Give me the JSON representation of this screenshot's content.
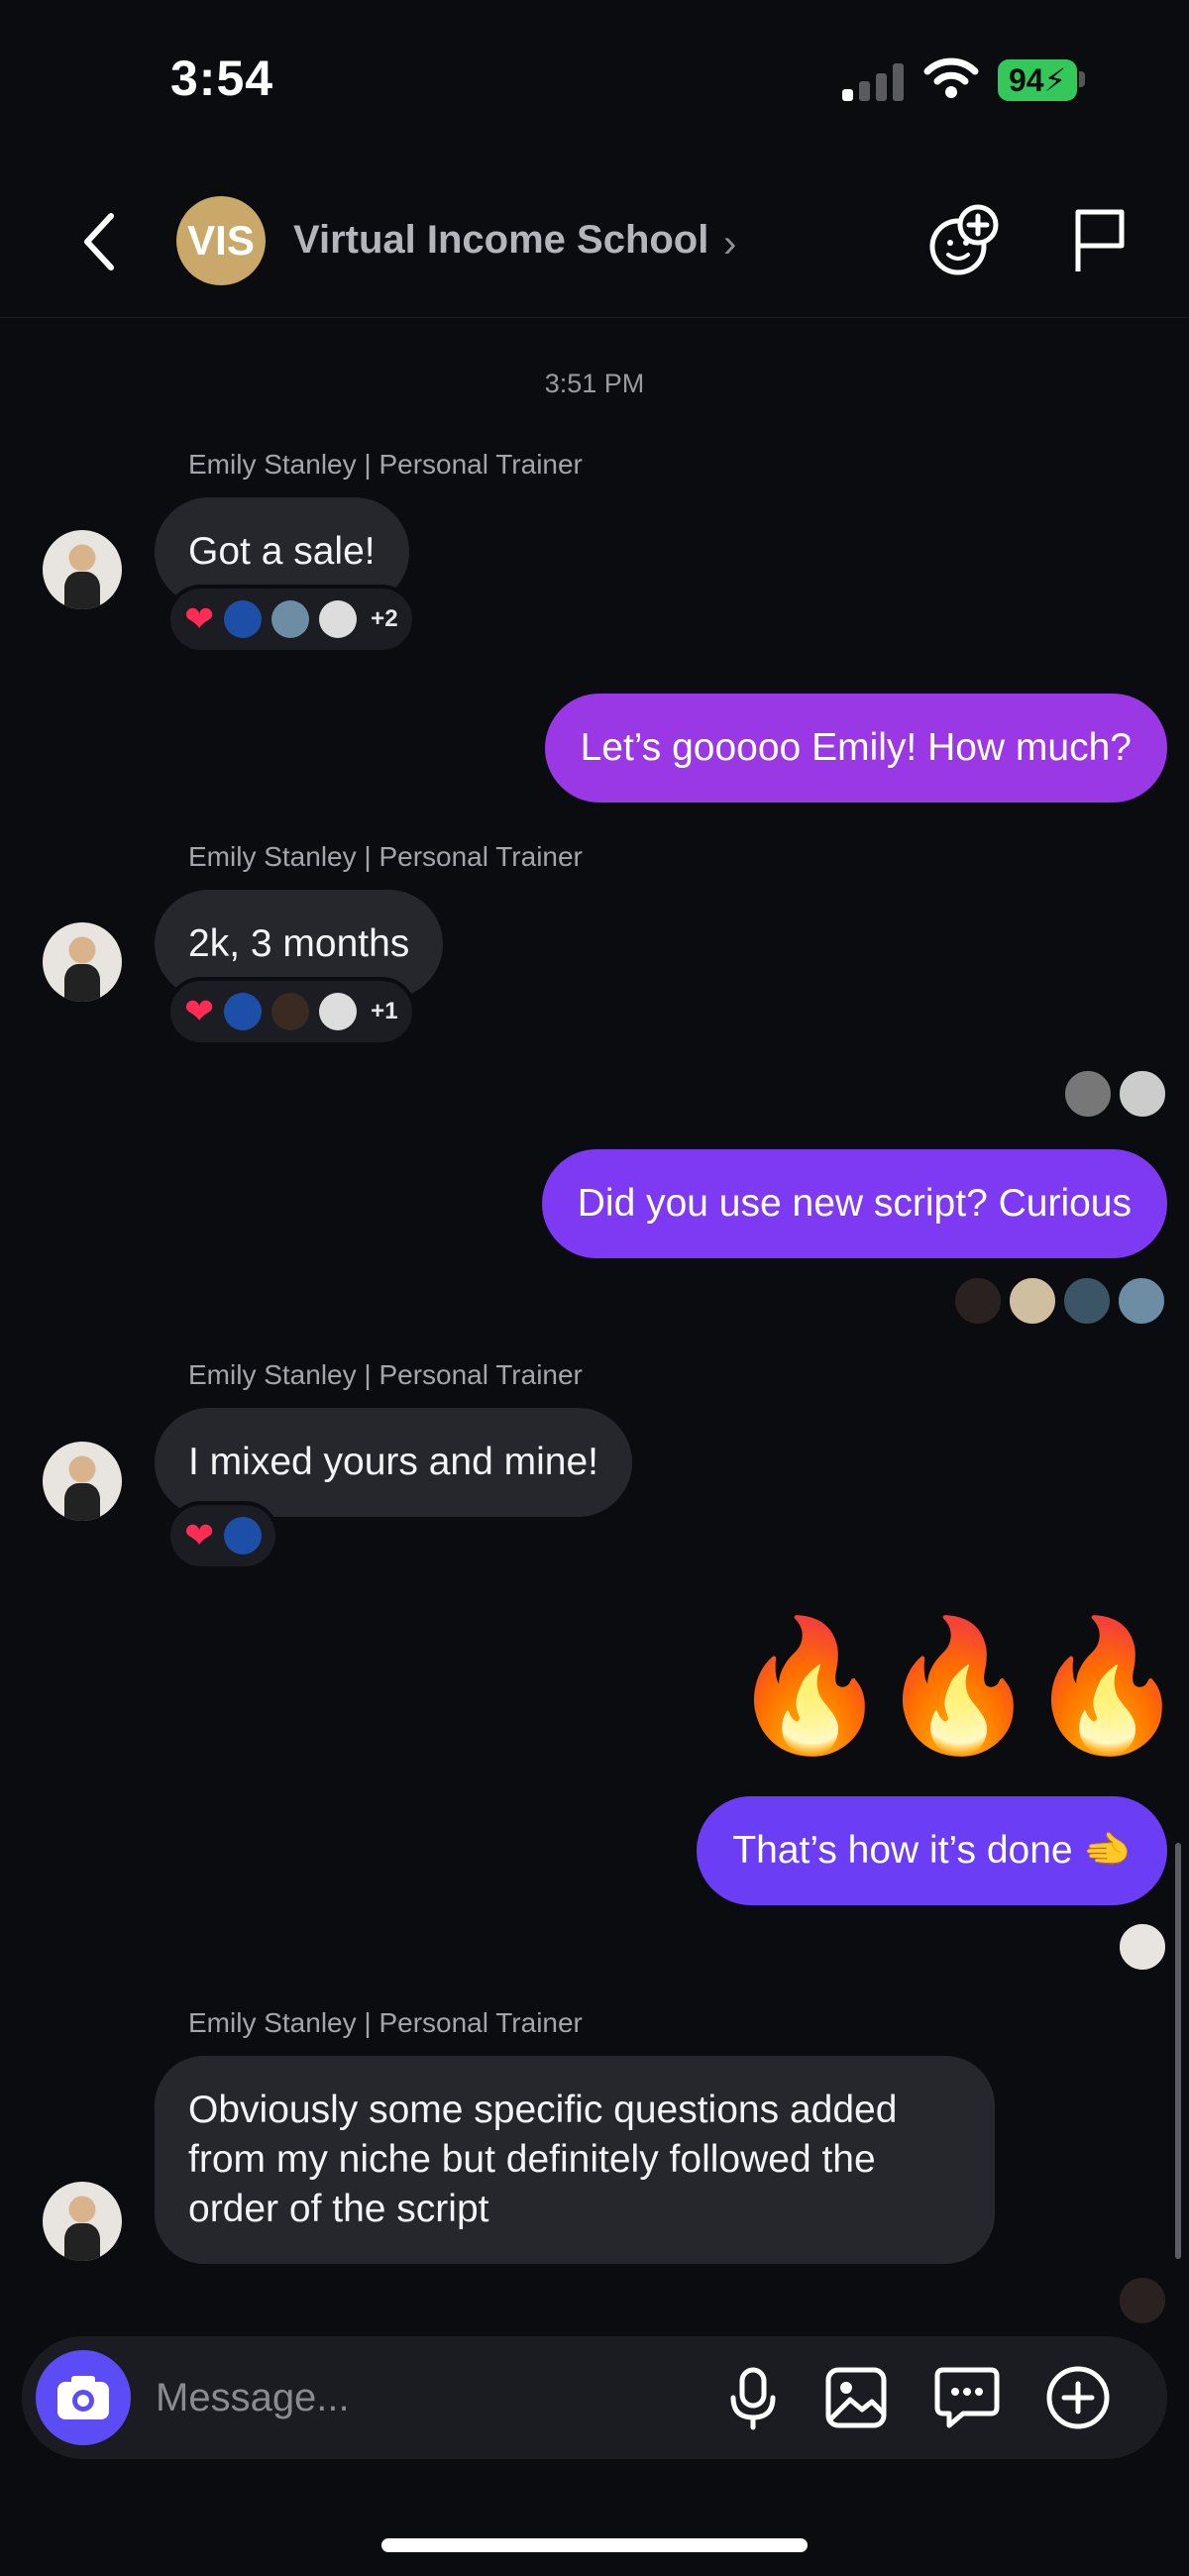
{
  "status_bar": {
    "time": "3:54",
    "battery": "94"
  },
  "header": {
    "group_initials": "VIS",
    "group_name": "Virtual Income School"
  },
  "chat": {
    "timestamp": "3:51 PM",
    "messages": [
      {
        "sender": "Emily Stanley | Personal Trainer",
        "text": "Got a sale!",
        "reaction_more": "+2"
      },
      {
        "text": "Let’s gooooo Emily! How much?"
      },
      {
        "sender": "Emily Stanley | Personal Trainer",
        "text": "2k, 3 months",
        "reaction_more": "+1"
      },
      {
        "text": "Did you use new script? Curious"
      },
      {
        "sender": "Emily Stanley | Personal Trainer",
        "text": "I mixed yours and mine!"
      },
      {
        "fire": "🔥"
      },
      {
        "text": "That’s how it’s done 🫲"
      },
      {
        "sender": "Emily Stanley | Personal Trainer",
        "text": "Obviously some specific questions added from my niche but definitely followed the order of the script"
      }
    ],
    "heart": "❤",
    "colors": {
      "accent": "#5b4cf5",
      "bubble_out_1": "#9b38e6",
      "bubble_out_2": "#7e3af2",
      "bubble_out_3": "#6b3df5",
      "bubble_in": "#26272d"
    }
  },
  "composer": {
    "placeholder": "Message..."
  }
}
